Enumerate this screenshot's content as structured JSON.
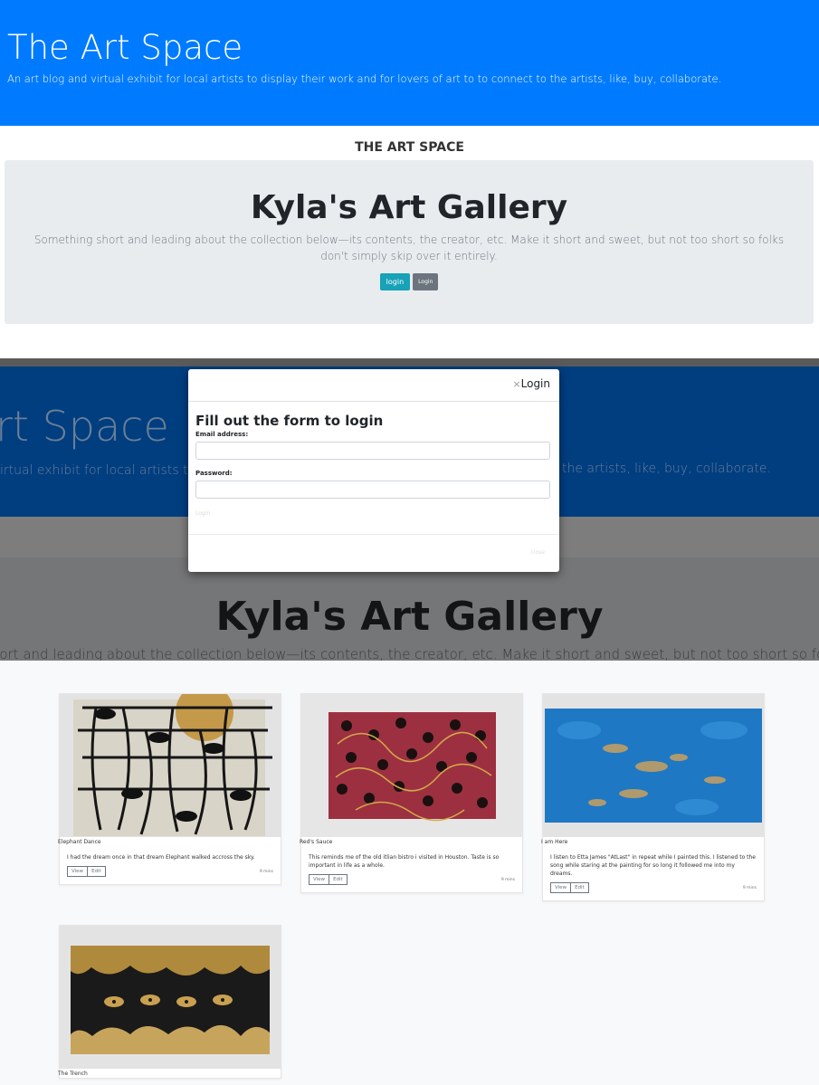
{
  "header": {
    "title": "The Art Space",
    "subtitle": "An art blog and virtual exhibit for local artists to display their work and for lovers of art to to connect to the artists, like, buy, collaborate."
  },
  "brand": "THE ART SPACE",
  "jumbotron": {
    "title": "Kyla's Art Gallery",
    "lead": "Something short and leading about the collection below—its contents, the creator, etc. Make it short and sweet, but not too short so folks don't simply skip over it entirely.",
    "login_button": "login",
    "login_button2": "Login"
  },
  "modal_view": {
    "bg_title": "rt Space",
    "bg_subtitle_left": "irtual exhibit for local artists t",
    "bg_subtitle_right": "the artists, like, buy, collaborate.",
    "bg_gallery_title": "Kyla's Art Gallery",
    "bg_lead": "short and leading about the collection below—its contents, the creator, etc. Make it short and sweet, but not too short so folk",
    "modal": {
      "close_x": "×",
      "header_title": "Login",
      "heading": "Fill out the form to login",
      "email_label": "Email address:",
      "password_label": "Password:",
      "submit": "Login",
      "close": "close"
    }
  },
  "gallery": {
    "cards": [
      {
        "title": "Elephant Dance",
        "description": "I had the dream once in that dream Elephant walked accross the sky.",
        "view": "View",
        "edit": "Edit",
        "time": "9 mins",
        "art": "elephant-dance-painting"
      },
      {
        "title": "Red's Sauce",
        "description": "This reminds me of the old itlian bistro i visited in Houston. Taste is so important in life as a whole.",
        "view": "View",
        "edit": "Edit",
        "time": "9 mins",
        "art": "reds-sauce-painting"
      },
      {
        "title": "I am Here",
        "description": "I listen to Etta James \"AtLast\" in repeat while I painted this. I listened to the song while staring at the painting for so long it followed me into my dreams.",
        "view": "View",
        "edit": "Edit",
        "time": "9 mins",
        "art": "i-am-here-painting"
      },
      {
        "title": "The Trench",
        "art": "the-trench-painting"
      }
    ]
  },
  "colors": {
    "primary": "#007bff",
    "info": "#17a2b8",
    "secondary": "#6c757d",
    "jumbotron_bg": "#e9ecef",
    "page_bg": "#f8f9fa"
  }
}
